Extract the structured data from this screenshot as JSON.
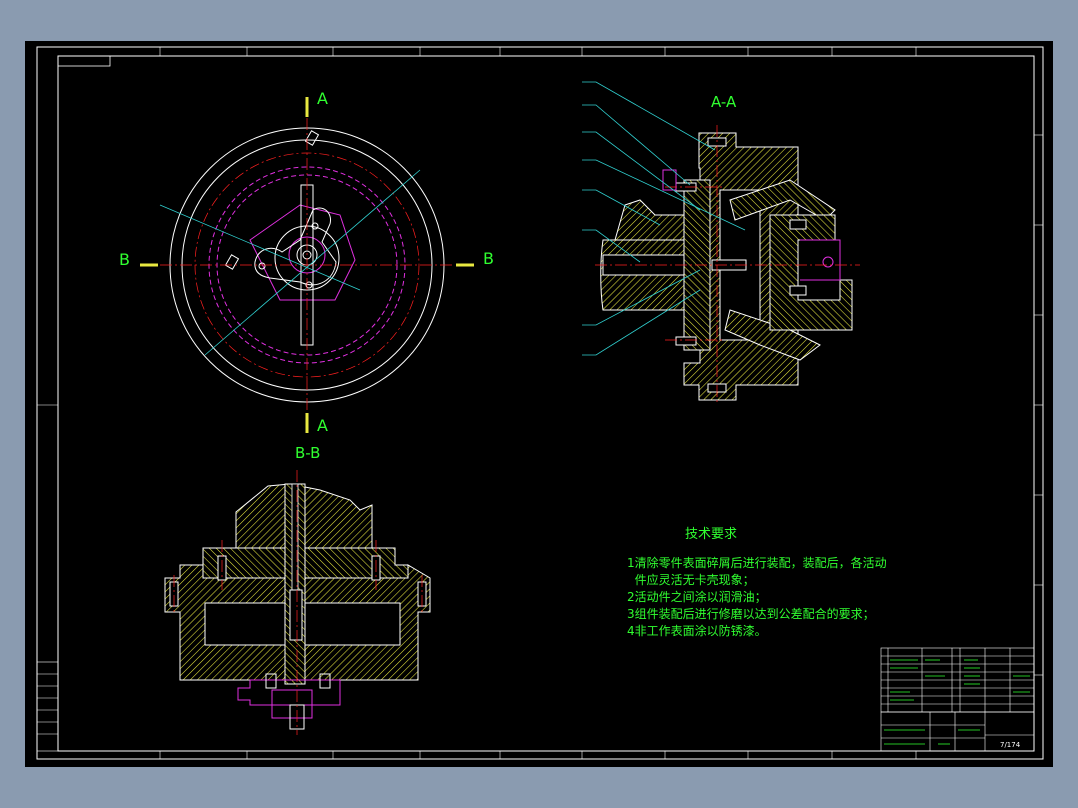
{
  "colors": {
    "background": "#8a9bb0",
    "sheet": "#000000",
    "frame": "#ffffff",
    "outline": "#ffffff",
    "center_line": "#ff2020",
    "hidden": "#e030e0",
    "hatch": "#e8e840",
    "leader": "#30d0d0",
    "label": "#30ff30",
    "text": "#30ff30"
  },
  "views": {
    "section_aa_title": "A-A",
    "section_bb_title": "B-B",
    "cut_a_top": "A",
    "cut_a_bottom": "A",
    "cut_b_left": "B",
    "cut_b_right": "B"
  },
  "tech_requirements": {
    "title": "技术要求",
    "items": [
      "1清除零件表面碎屑后进行装配，装配后，各活动",
      "  件应灵活无卡壳现象；",
      "2活动件之间涂以润滑油；",
      "3组件装配后进行修磨以达到公差配合的要求；",
      "4非工作表面涂以防锈漆。"
    ]
  },
  "title_block": {
    "drawing_code": "7/174"
  }
}
